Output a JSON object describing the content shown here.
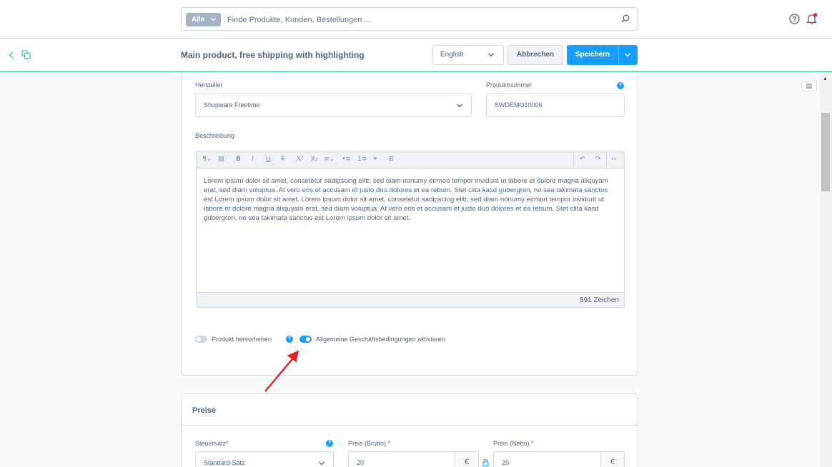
{
  "header": {
    "search_type": "Alle",
    "search_placeholder": "Finde Produkte, Kunden, Bestellungen ...",
    "icons": [
      "search-icon",
      "help-icon",
      "bell-icon"
    ]
  },
  "smartbar": {
    "title": "Main product, free shipping with highlighting",
    "language": "English",
    "cancel_label": "Abbrechen",
    "save_label": "Speichern"
  },
  "general": {
    "manufacturer_label": "Hersteller",
    "manufacturer_value": "Shopware Freetime",
    "product_number_label": "Produktnummer",
    "product_number_value": "SWDEMO10006",
    "description_label": "Beschreibung",
    "description_text": "Lorem ipsum dolor sit amet, consetetur sadipscing elitr, sed diam nonumy eirmod tempor invidunt ut labore et dolore magna aliquyam erat, sed diam voluptua. At vero eos et accusam et justo duo dolores et ea rebum. Stet clita kasd gubergren, no sea takimata sanctus est Lorem ipsum dolor sit amet. Lorem ipsum dolor sit amet, consetetur sadipscing elitr, sed diam nonumy eirmod tempor invidunt ut labore et dolore magna aliquyam erat, sed diam voluptua. At vero eos et accusam et justo duo dolores et ea rebum. Stet clita kasd gubergren, no sea takimata sanctus est Lorem ipsum dolor sit amet.",
    "char_count": "591 Zeichen",
    "toggle_highlight_label": "Produkt hervorheben",
    "toggle_highlight_on": false,
    "toggle_terms_label": "Allgemeine Geschäftsbedingungen aktivieren",
    "toggle_terms_on": true
  },
  "prices": {
    "title": "Preise",
    "tax_label": "Steuersatz*",
    "tax_value": "Standard-Satz",
    "gross_label": "Preis (Brutto) *",
    "gross_value": "20",
    "net_label": "Preis (Netto) *",
    "net_value": "20",
    "currency": "€"
  },
  "colors": {
    "primary": "#189eff",
    "accent_line": "#3cc5a3",
    "arrow": "#e52020",
    "notification": "#de294c"
  }
}
